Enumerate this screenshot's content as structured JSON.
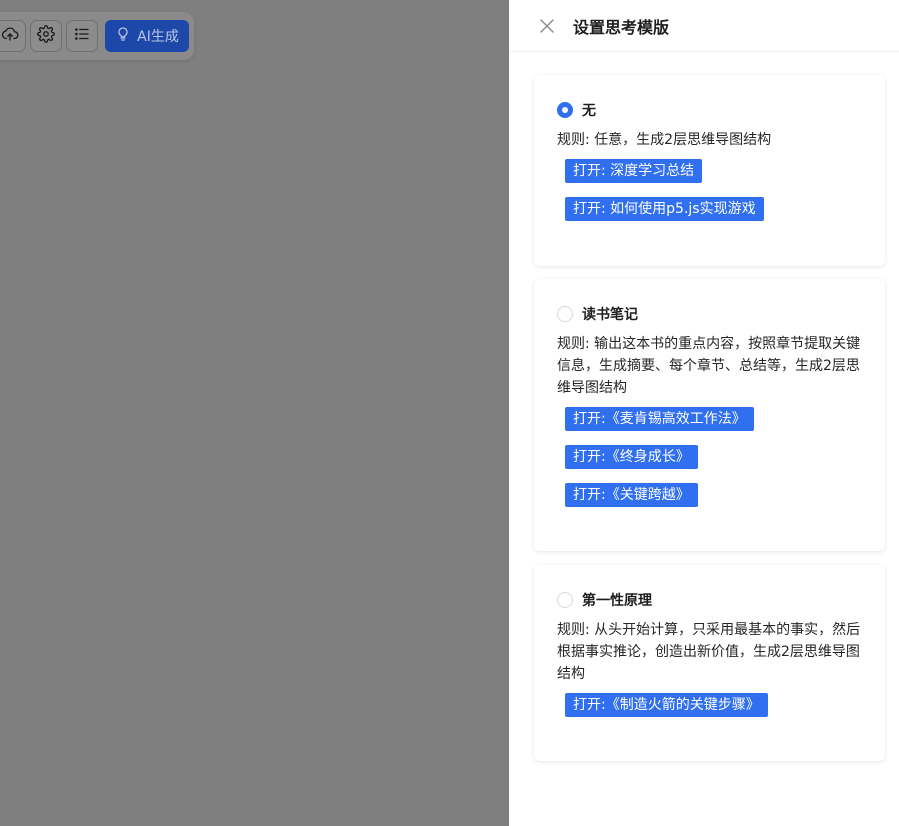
{
  "toolbar": {
    "ai_label": "AI生成",
    "icons": [
      "cloud-upload-icon",
      "gear-icon",
      "list-icon",
      "lightbulb-icon"
    ]
  },
  "drawer": {
    "title": "设置思考模版",
    "templates": [
      {
        "name": "无",
        "selected": true,
        "rule": "规则: 任意，生成2层思维导图结构",
        "links": [
          "打开: 深度学习总结",
          "打开: 如何使用p5.js实现游戏"
        ]
      },
      {
        "name": "读书笔记",
        "selected": false,
        "rule": "规则: 输出这本书的重点内容，按照章节提取关键信息，生成摘要、每个章节、总结等，生成2层思维导图结构",
        "links": [
          "打开:《麦肯锡高效工作法》",
          "打开:《终身成长》",
          "打开:《关键跨越》"
        ]
      },
      {
        "name": "第一性原理",
        "selected": false,
        "rule": "规则: 从头开始计算，只采用最基本的事实，然后根据事实推论，创造出新价值，生成2层思维导图结构",
        "links": [
          "打开:《制造火箭的关键步骤》"
        ]
      }
    ]
  },
  "colors": {
    "accent": "#2f6ff0",
    "ai_button": "#1d47a8",
    "overlay": "#7f7f7f"
  }
}
